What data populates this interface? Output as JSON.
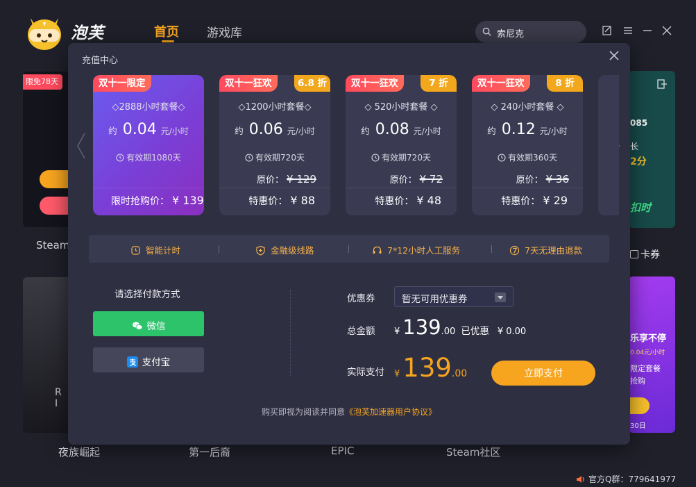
{
  "app": {
    "brand": "泡芙",
    "nav": {
      "home": "首页",
      "library": "游戏库"
    },
    "search": {
      "value": "索尼克"
    },
    "footer": {
      "qq_label": "官方Q群：",
      "qq_number": "779641977"
    }
  },
  "background": {
    "badge_free": "限免78天",
    "side_numbers": {
      "code": "085",
      "long": "长",
      "minutes": "2分",
      "time": "扣时"
    },
    "card_voucher": "卡券",
    "promo": {
      "line1": "乐享不停",
      "line2": "0.04元/小时",
      "line3": "限定套餐",
      "line4": "抢购",
      "date": "30日"
    },
    "game_letters": "R I",
    "labels": [
      "Steam",
      "夜族崛起",
      "第一后裔",
      "EPIC",
      "Steam社区"
    ]
  },
  "modal": {
    "title": "充值中心",
    "packages": [
      {
        "tag": "双十一限定",
        "name": "◇2888小时套餐◇",
        "approx": "约",
        "price": "0.04",
        "unit": "元/小时",
        "validity": "有效期1080天",
        "sale_label": "限时抢购价：",
        "sale_price": "¥ 139"
      },
      {
        "tag": "双十一狂欢",
        "discount": "6.8 折",
        "name": "◇1200小时套餐◇",
        "approx": "约",
        "price": "0.06",
        "unit": "元/小时",
        "validity": "有效期720天",
        "orig_label": "原价：",
        "orig_price": "¥ 129",
        "sale_label": "特惠价：",
        "sale_price": "¥ 88"
      },
      {
        "tag": "双十一狂欢",
        "discount": "7 折",
        "name": "◇ 520小时套餐 ◇",
        "approx": "约",
        "price": "0.08",
        "unit": "元/小时",
        "validity": "有效期720天",
        "orig_label": "原价：",
        "orig_price": "¥ 72",
        "sale_label": "特惠价：",
        "sale_price": "¥ 48"
      },
      {
        "tag": "双十一狂欢",
        "discount": "8 折",
        "name": "◇ 240小时套餐 ◇",
        "approx": "约",
        "price": "0.12",
        "unit": "元/小时",
        "validity": "有效期360天",
        "orig_label": "原价：",
        "orig_price": "¥ 36",
        "sale_label": "特惠价：",
        "sale_price": "¥ 29"
      }
    ],
    "features": [
      "智能计时",
      "金融级线路",
      "7*12小时人工服务",
      "7天无理由退款"
    ],
    "payment": {
      "title": "请选择付款方式",
      "wechat": "微信",
      "alipay": "支付宝"
    },
    "coupon": {
      "label": "优惠券",
      "value": "暂无可用优惠券"
    },
    "total": {
      "label": "总金额",
      "currency": "¥",
      "int": "139",
      "dec": ".00",
      "saved_label": "已优惠",
      "saved_value": "¥ 0.00"
    },
    "actual": {
      "label": "实际支付",
      "currency": "¥",
      "int": "139",
      "dec": ".00"
    },
    "pay_button": "立即支付",
    "agreement": {
      "text": "购买即视为阅读并同意",
      "link": "《泡芙加速器用户协议》"
    }
  },
  "colors": {
    "accent": "#f7a51f",
    "wechat": "#2cc36b",
    "tag_red": "#ff4a5e",
    "discount": "#f3a71c",
    "modal_bg": "#2f2f42",
    "page_bg": "#20202b"
  }
}
